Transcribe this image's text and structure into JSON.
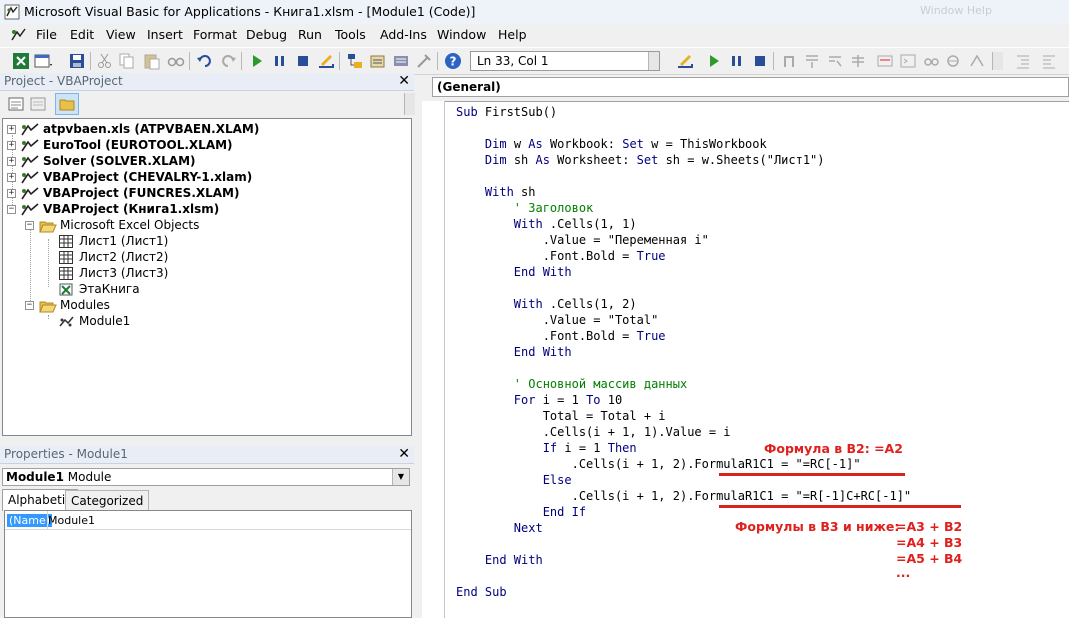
{
  "window": {
    "title": "Microsoft Visual Basic for Applications - Книга1.xlsm - [Module1 (Code)]",
    "blurred_right": "Window  Help"
  },
  "menu": [
    "File",
    "Edit",
    "View",
    "Insert",
    "Format",
    "Debug",
    "Run",
    "Tools",
    "Add-Ins",
    "Window",
    "Help"
  ],
  "toolbar": {
    "position": "Ln 33, Col 1"
  },
  "project": {
    "title": "Project - VBAProject",
    "items": [
      {
        "label": "atpvbaen.xls (ATPVBAEN.XLAM)",
        "bold": true
      },
      {
        "label": "EuroTool (EUROTOOL.XLAM)",
        "bold": true
      },
      {
        "label": "Solver (SOLVER.XLAM)",
        "bold": true
      },
      {
        "label": "VBAProject (CHEVALRY-1.xlam)",
        "bold": true
      },
      {
        "label": "VBAProject (FUNCRES.XLAM)",
        "bold": true
      },
      {
        "label": "VBAProject (Книга1.xlsm)",
        "bold": true
      },
      {
        "label": "Microsoft Excel Objects",
        "bold": false
      },
      {
        "label": "Лист1 (Лист1)",
        "bold": false
      },
      {
        "label": "Лист2 (Лист2)",
        "bold": false
      },
      {
        "label": "Лист3 (Лист3)",
        "bold": false
      },
      {
        "label": "ЭтаКнига",
        "bold": false
      },
      {
        "label": "Modules",
        "bold": false
      },
      {
        "label": "Module1",
        "bold": false
      }
    ]
  },
  "properties": {
    "title": "Properties - Module1",
    "object_name": "Module1",
    "object_type": "Module",
    "tabs": [
      "Alphabetic",
      "Categorized"
    ],
    "rows": [
      {
        "name": "(Name)",
        "value": "Module1"
      }
    ]
  },
  "code": {
    "object_combo": "(General)",
    "lines": [
      "Sub FirstSub()",
      "",
      "    Dim w As Workbook: Set w = ThisWorkbook",
      "    Dim sh As Worksheet: Set sh = w.Sheets(\"Лист1\")",
      "",
      "    With sh",
      "        ' Заголовок",
      "        With .Cells(1, 1)",
      "            .Value = \"Переменная i\"",
      "            .Font.Bold = True",
      "        End With",
      "",
      "        With .Cells(1, 2)",
      "            .Value = \"Total\"",
      "            .Font.Bold = True",
      "        End With",
      "",
      "        ' Основной массив данных",
      "        For i = 1 To 10",
      "            Total = Total + i",
      "            .Cells(i + 1, 1).Value = i",
      "            If i = 1 Then",
      "                .Cells(i + 1, 2).FormulaR1C1 = \"=RC[-1]\"",
      "            Else",
      "                .Cells(i + 1, 2).FormulaR1C1 = \"=R[-1]C+RC[-1]\"",
      "            End If",
      "        Next",
      "",
      "    End With",
      "",
      "End Sub"
    ]
  },
  "annotations": {
    "b2": "Формула в B2:  =A2",
    "b3_label": "Формулы в B3 и ниже:",
    "b3_lines": [
      "=A3 + B2",
      "=A4 + B3",
      "=A5 + B4",
      "..."
    ]
  }
}
